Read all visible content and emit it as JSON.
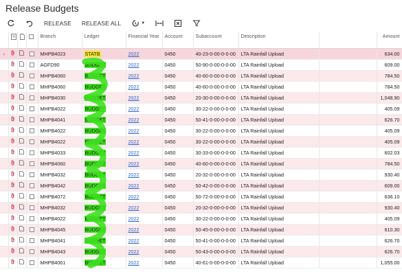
{
  "page": {
    "title": "Release Budgets"
  },
  "toolbar": {
    "release_label": "RELEASE",
    "release_all_label": "RELEASE ALL",
    "icons": [
      "refresh-icon",
      "undo-icon",
      "clock-dropdown-icon",
      "fit-columns-icon",
      "excel-export-icon",
      "filter-icon"
    ]
  },
  "grid": {
    "columns": {
      "branch": "Branch",
      "ledger": "Ledger",
      "financial_year": "Financial Year",
      "account": "Account",
      "subaccount": "Subaccount",
      "description": "Description",
      "amount": "Amount"
    },
    "rows": [
      {
        "branch": "MHPB4023",
        "ledger": "STATB",
        "year": "2022",
        "account": "0450",
        "sub": "40-23-0-00-0-0-00",
        "desc": "LTA Rainfall Upload",
        "amount": "634.00"
      },
      {
        "branch": "AGFD90",
        "ledger": "BUDGET",
        "year": "2022",
        "account": "0450",
        "sub": "50-90-0-00-0-0-00",
        "desc": "LTA Rainfall Upload",
        "amount": "609.00"
      },
      {
        "branch": "MHPB4060",
        "ledger": "BUDGET",
        "year": "2022",
        "account": "0450",
        "sub": "40-60-0-00-0-0-00",
        "desc": "LTA Rainfall Upload",
        "amount": "784.50"
      },
      {
        "branch": "MHPB4060",
        "ledger": "BUDGET",
        "year": "2022",
        "account": "0450",
        "sub": "40-60-0-00-0-0-00",
        "desc": "LTA Rainfall Upload",
        "amount": "784.50"
      },
      {
        "branch": "MHPB4030",
        "ledger": "BUDGET",
        "year": "2022",
        "account": "0450",
        "sub": "20-30-0-00-0-0-00",
        "desc": "LTA Rainfall Upload",
        "amount": "1,048.90"
      },
      {
        "branch": "MHPB4022",
        "ledger": "BUDGET",
        "year": "2022",
        "account": "0450",
        "sub": "30-22-0-00-0-0-00",
        "desc": "LTA Rainfall Upload",
        "amount": "405.09"
      },
      {
        "branch": "MHPB4041",
        "ledger": "BUDGET",
        "year": "2022",
        "account": "0450",
        "sub": "50-41-0-00-0-0-00",
        "desc": "LTA Rainfall Upload",
        "amount": "626.70"
      },
      {
        "branch": "MHPB4022",
        "ledger": "BUDGET",
        "year": "2022",
        "account": "0450",
        "sub": "30-22-0-00-0-0-00",
        "desc": "LTA Rainfall Upload",
        "amount": "405.09"
      },
      {
        "branch": "MHPB4022",
        "ledger": "BUDGET",
        "year": "2022",
        "account": "0450",
        "sub": "30-22-0-00-0-0-00",
        "desc": "LTA Rainfall Upload",
        "amount": "405.09"
      },
      {
        "branch": "MHPB4033",
        "ledger": "BUDGET",
        "year": "2022",
        "account": "0450",
        "sub": "30-33-0-00-0-0-00",
        "desc": "LTA Rainfall Upload",
        "amount": "602.03"
      },
      {
        "branch": "MHPB4060",
        "ledger": "BUDGET",
        "year": "2022",
        "account": "0450",
        "sub": "40-60-0-00-0-0-00",
        "desc": "LTA Rainfall Upload",
        "amount": "784.50"
      },
      {
        "branch": "MHPB4032",
        "ledger": "BUDGET",
        "year": "2022",
        "account": "0450",
        "sub": "20-32-0-00-0-0-00",
        "desc": "LTA Rainfall Upload",
        "amount": "930.40"
      },
      {
        "branch": "MHPB4042",
        "ledger": "BUDGET",
        "year": "2022",
        "account": "0450",
        "sub": "50-42-0-00-0-0-00",
        "desc": "LTA Rainfall Upload",
        "amount": "609.00"
      },
      {
        "branch": "MHPB4072",
        "ledger": "BUDGET",
        "year": "2022",
        "account": "0450",
        "sub": "50-72-0-00-0-0-00",
        "desc": "LTA Rainfall Upload",
        "amount": "636.10"
      },
      {
        "branch": "MHPB4032",
        "ledger": "BUDGET",
        "year": "2022",
        "account": "0450",
        "sub": "20-32-0-00-0-0-00",
        "desc": "LTA Rainfall Upload",
        "amount": "930.40"
      },
      {
        "branch": "MHPB4022",
        "ledger": "BUDGET",
        "year": "2022",
        "account": "0450",
        "sub": "30-22-0-00-0-0-00",
        "desc": "LTA Rainfall Upload",
        "amount": "405.09"
      },
      {
        "branch": "MHPB4045",
        "ledger": "BUDGET",
        "year": "2022",
        "account": "0450",
        "sub": "50-45-0-00-0-0-00",
        "desc": "LTA Rainfall Upload",
        "amount": "610.30"
      },
      {
        "branch": "MHPB4041",
        "ledger": "BUDGET",
        "year": "2022",
        "account": "0450",
        "sub": "50-41-0-00-0-0-00",
        "desc": "LTA Rainfall Upload",
        "amount": "626.70"
      },
      {
        "branch": "MHPB4043",
        "ledger": "BUDGET",
        "year": "2022",
        "account": "0450",
        "sub": "50-43-0-00-0-0-00",
        "desc": "LTA Rainfall Upload",
        "amount": "626.70"
      },
      {
        "branch": "MHPB4061",
        "ledger": "BUDGET",
        "year": "2022",
        "account": "0450",
        "sub": "40-61-0-00-0-0-00",
        "desc": "LTA Rainfall Upload",
        "amount": "1,055.00"
      }
    ]
  },
  "colors": {
    "highlight_yellow": "#f6e81a",
    "highlight_green": "#3ee01f",
    "link_blue": "#2a64c8",
    "row_stripe": "#fbe9ec",
    "selected_row": "#f8d5dc"
  }
}
